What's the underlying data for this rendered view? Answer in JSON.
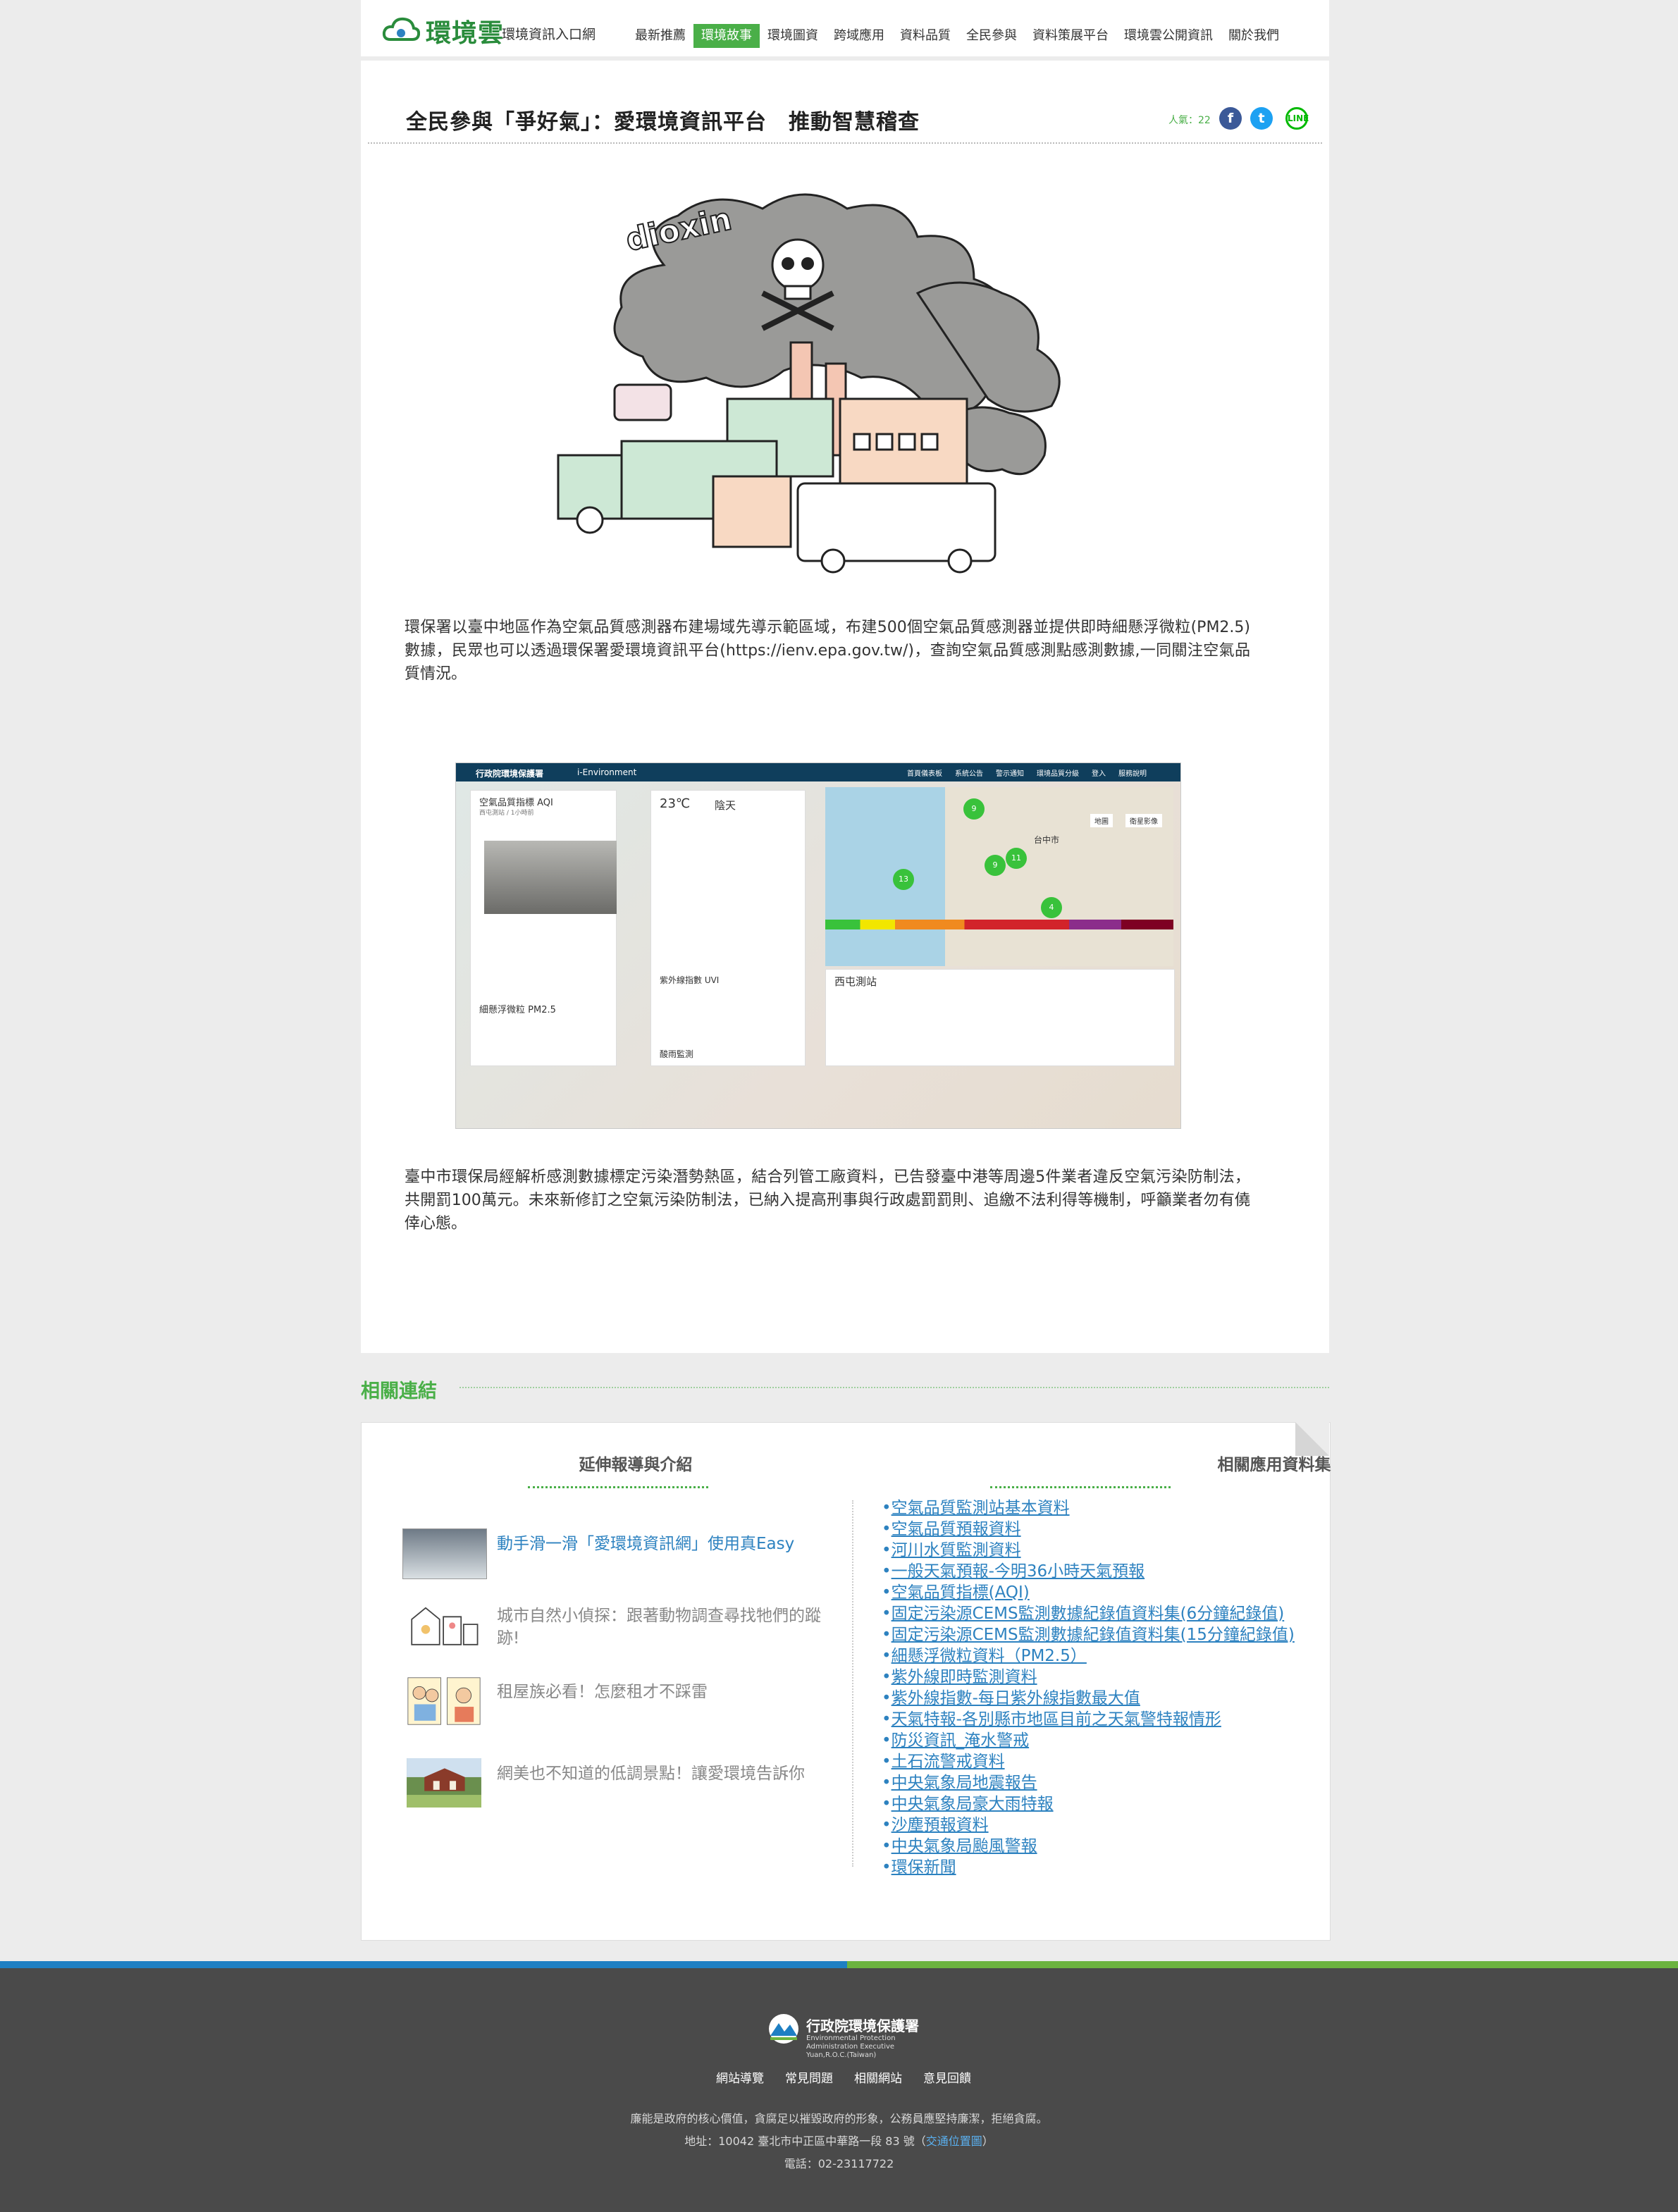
{
  "header": {
    "logo_text": "環境雲",
    "logo_sub": "環境資訊入口網",
    "nav": [
      "最新推薦",
      "環境故事",
      "環境圖資",
      "跨域應用",
      "資料品質",
      "全民參與",
      "資料策展平台",
      "環境雲公開資訊",
      "關於我們"
    ],
    "active_nav": "環境故事"
  },
  "article": {
    "title": "全民參與「爭好氣」：愛環境資訊平台　推動智慧稽查",
    "views": "人氣：22",
    "share": {
      "facebook": "f",
      "twitter": "t",
      "line": "LINE"
    },
    "illustration_word": "dioxin",
    "para1": "環保署以臺中地區作為空氣品質感測器布建場域先導示範區域，布建500個空氣品質感測器並提供即時細懸浮微粒(PM2.5)數據，民眾也可以透過環保署愛環境資訊平台(https://ienv.epa.gov.tw/)，查詢空氣品質感測點感測數據,一同關注空氣品質情況。",
    "para2": "臺中市環保局經解析感測數據標定污染潛勢熱區，結合列管工廠資料，已告發臺中港等周邊5件業者違反空氣污染防制法，共開罰100萬元。未來新修訂之空氣污染防制法，已納入提高刑事與行政處罰罰則、追繳不法利得等機制，呼籲業者勿有僥倖心態。",
    "screenshot": {
      "brand": "行政院環境保護署",
      "brand_en": "i-Environment",
      "menu": [
        "首頁儀表板",
        "系統公告",
        "警示通知",
        "環境品質分級",
        "登入",
        "服務說明"
      ],
      "aqi_title": "空氣品質指標 AQI",
      "aqi_sub": "西屯測站 / 1小時前",
      "temp": "23℃",
      "weather": "陰天",
      "uvi_title": "紫外線指數 UVI",
      "pm25_title": "細懸浮微粒 PM2.5",
      "acid_title": "酸雨監測",
      "station_title": "西屯測站",
      "map_city": "台中市",
      "map_tabs": [
        "地圖",
        "衛星影像"
      ],
      "cluster_counts": [
        "9",
        "13",
        "9",
        "11",
        "4"
      ]
    }
  },
  "related": {
    "title": "相關連結",
    "ext_head": "延伸報導與介紹",
    "app_head": "相關應用資料集",
    "stories": [
      {
        "title": "動手滑一滑「愛環境資訊網」使用真Easy"
      },
      {
        "title": "城市自然小偵探：跟著動物調查尋找牠們的蹤跡!"
      },
      {
        "title": "租屋族必看！怎麼租才不踩雷"
      },
      {
        "title": "網美也不知道的低調景點！讓愛環境告訴你"
      }
    ],
    "datasets": [
      "空氣品質監測站基本資料",
      "空氣品質預報資料",
      "河川水質監測資料",
      "一般天氣預報-今明36小時天氣預報",
      "空氣品質指標(AQI)",
      "固定污染源CEMS監測數據紀錄值資料集(6分鐘紀錄值)",
      "固定污染源CEMS監測數據紀錄值資料集(15分鐘紀錄值)",
      "細懸浮微粒資料（PM2.5）",
      "紫外線即時監測資料",
      "紫外線指數-每日紫外線指數最大值",
      "天氣特報-各別縣市地區目前之天氣警特報情形",
      "防災資訊_淹水警戒",
      "土石流警戒資料",
      "中央氣象局地震報告",
      "中央氣象局豪大雨特報",
      "沙塵預報資料",
      "中央氣象局颱風警報",
      "環保新聞"
    ]
  },
  "footer": {
    "org": "行政院環境保護署",
    "org_en": "Environmental Protection Administration Executive Yuan,R.O.C.(Taiwan)",
    "links": [
      "網站導覽",
      "常見問題",
      "相關網站",
      "意見回饋"
    ],
    "slogan": "廉能是政府的核心價值，貪腐足以摧毀政府的形象，公務員應堅持廉潔，拒絕貪腐。",
    "address_prefix": "地址：10042 臺北市中正區中華路一段 83 號（",
    "map_link": "交通位置圖",
    "address_suffix": "）",
    "tel": "電話：02-23117722"
  },
  "colors": {
    "brand_green": "#4aaf48",
    "link_blue": "#2d82c0",
    "footer_bg": "#4a4a4a"
  }
}
